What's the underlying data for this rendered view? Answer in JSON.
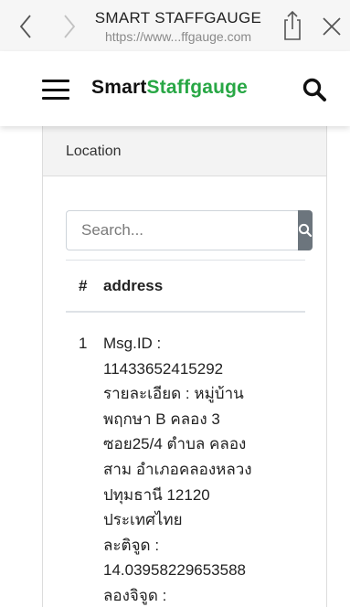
{
  "browser": {
    "title": "SMART STAFFGAUGE",
    "url": "https://www...ffgauge.com",
    "icons": {
      "back": "chevron-left-icon",
      "forward": "chevron-right-icon",
      "share": "share-icon",
      "close": "close-icon"
    }
  },
  "navbar": {
    "brand_part1": "Smart",
    "brand_part2": "Staffgauge",
    "brand_accent_color": "#28a745",
    "icons": {
      "menu": "hamburger-menu-icon",
      "search": "search-icon"
    }
  },
  "card": {
    "header": "Location",
    "search": {
      "placeholder": "Search...",
      "value": ""
    },
    "table": {
      "columns": [
        "#",
        "address"
      ],
      "rows": [
        {
          "num": "1",
          "address": "Msg.ID :\n11433652415292\nรายละเอียด : หมู่บ้าน\nพฤกษา B คลอง 3\nซอย25/4 ตำบล คลอง\nสาม อำเภอคลองหลวง\nปทุมธานี 12120\nประเทศไทย\nละติจูด :\n14.03958229653588\nลองจิจูด :"
        }
      ]
    }
  }
}
